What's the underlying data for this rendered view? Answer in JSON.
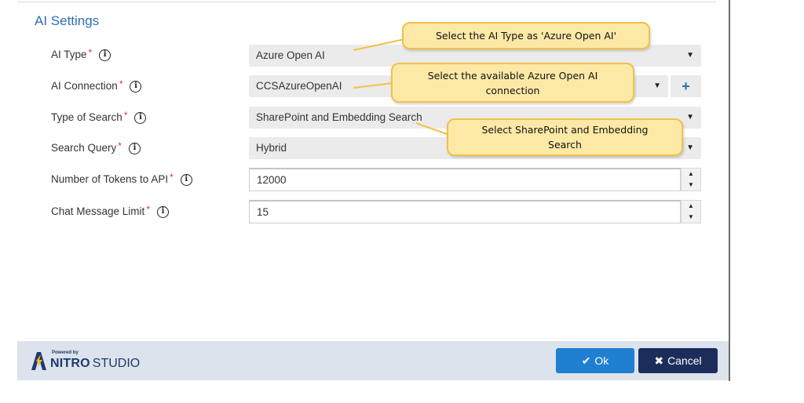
{
  "section": {
    "title": "AI Settings"
  },
  "fields": [
    {
      "label": "AI Type",
      "required": "*",
      "value": "Azure Open AI"
    },
    {
      "label": "AI Connection",
      "required": "*",
      "value": "CCSAzureOpenAI"
    },
    {
      "label": "Type of Search",
      "required": "*",
      "value": "SharePoint and Embedding Search"
    },
    {
      "label": "Search Query",
      "required": "*",
      "value": "Hybrid"
    },
    {
      "label": "Number of Tokens to API",
      "required": "*",
      "value": "12000"
    },
    {
      "label": "Chat Message Limit",
      "required": "*",
      "value": "15"
    }
  ],
  "add_connection": {
    "glyph": "+"
  },
  "callouts": [
    {
      "text": "Select the AI Type as 'Azure Open AI'"
    },
    {
      "text": "Select the available Azure Open AI connection"
    },
    {
      "text": "Select SharePoint and Embedding Search"
    }
  ],
  "footer": {
    "logo_tagline": "Powered by",
    "logo_name": "NITRO",
    "logo_suffix": "STUDIO",
    "ok_label": "Ok",
    "cancel_label": "Cancel"
  },
  "colors": {
    "accent": "#2e6fb5",
    "ok_button": "#1f7fd0",
    "cancel_button": "#1c2d5c",
    "callout_fill": "#fde9a6",
    "callout_border": "#f2c14a",
    "required": "#d9342b"
  },
  "icons": {
    "info": "info-circle-icon",
    "caret": "caret-down-icon",
    "spinner_up": "chevron-up-icon",
    "spinner_down": "chevron-down-icon",
    "ok": "check-icon",
    "cancel": "close-icon"
  }
}
